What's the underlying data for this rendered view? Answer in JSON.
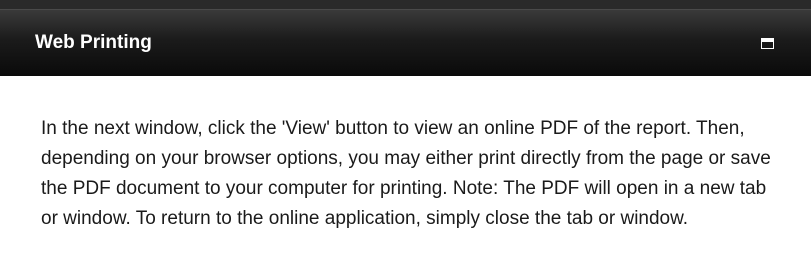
{
  "dialog": {
    "title": "Web Printing",
    "maximize_icon": "window-maximize-icon",
    "message": "In the next window, click the 'View' button to view an online PDF of the report. Then, depending on your browser options, you may either print directly from the page or save the PDF document to your computer for printing. Note: The PDF will open in a new tab or window. To return to the online application, simply close the tab or window."
  },
  "colors": {
    "titlebar": "#1b1b1b",
    "title_text": "#ffffff",
    "body_text": "#1a1a1a",
    "background": "#ffffff"
  }
}
